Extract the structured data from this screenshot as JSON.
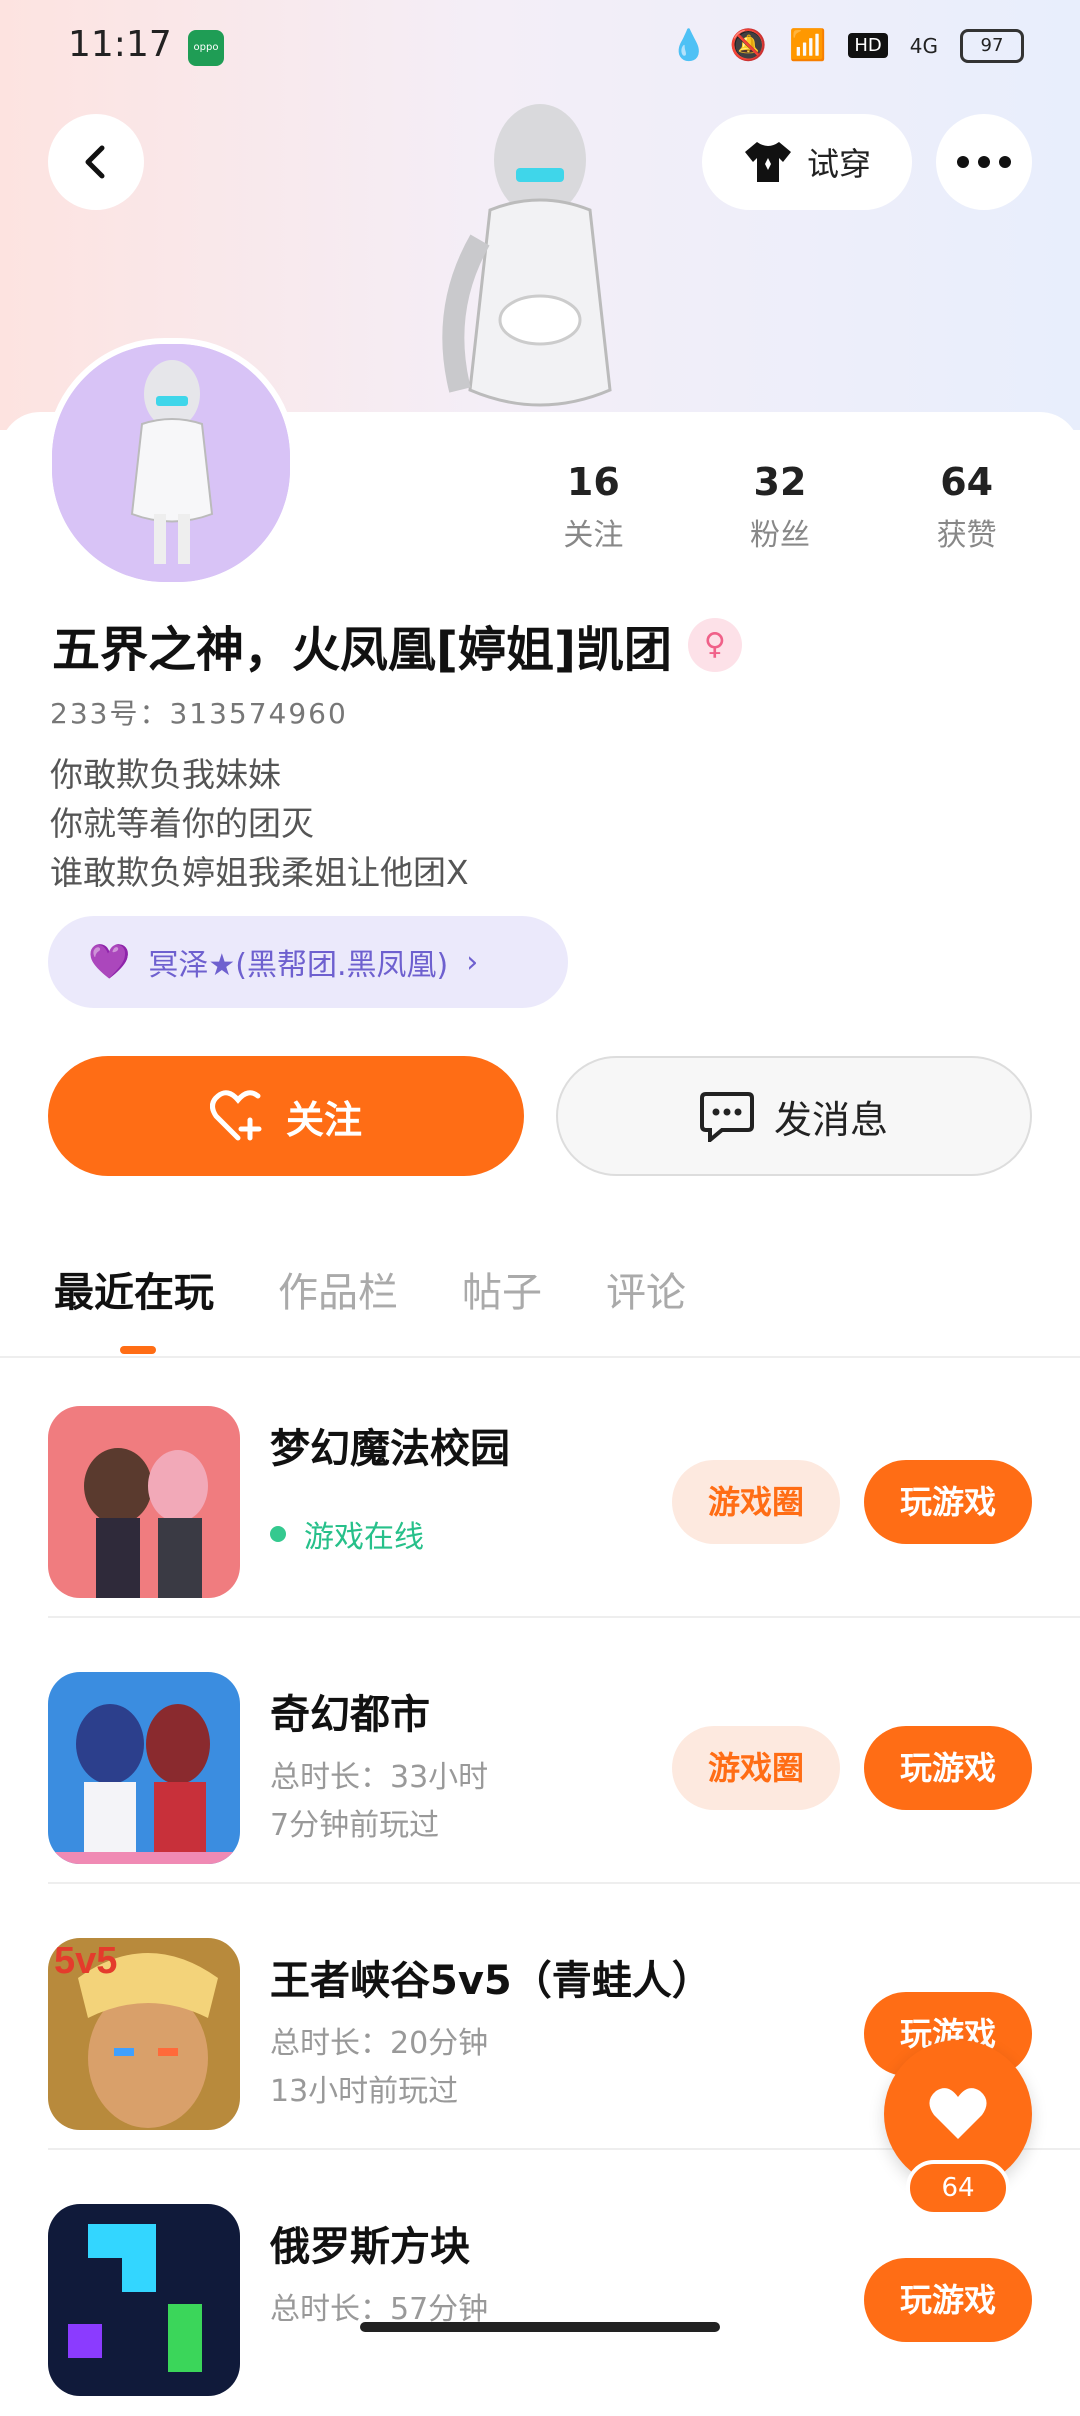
{
  "status_bar": {
    "time": "11:17",
    "carrier_badge": "oppo",
    "battery": "97",
    "hd": "HD",
    "network": "4G"
  },
  "header": {
    "try_label": "试穿"
  },
  "profile": {
    "stats": [
      {
        "value": "16",
        "label": "关注"
      },
      {
        "value": "32",
        "label": "粉丝"
      },
      {
        "value": "64",
        "label": "获赞"
      }
    ],
    "name": "五界之神，火凤凰[婷姐]凯团",
    "uid": "233号：313574960",
    "bio": [
      "你敢欺负我妹妹",
      "你就等着你的团灭",
      "谁敢欺负婷姐我柔姐让他团X"
    ],
    "group": "冥泽★(黑帮团.黑凤凰)"
  },
  "actions": {
    "follow": "关注",
    "message": "发消息"
  },
  "tabs": [
    "最近在玩",
    "作品栏",
    "帖子",
    "评论"
  ],
  "games": [
    {
      "title": "梦幻魔法校园",
      "online": "游戏在线",
      "circle_btn": "游戏圈",
      "play_btn": "玩游戏"
    },
    {
      "title": "奇幻都市",
      "duration": "总时长：33小时",
      "last": "7分钟前玩过",
      "circle_btn": "游戏圈",
      "play_btn": "玩游戏"
    },
    {
      "title": "王者峡谷5v5（青蛙人）",
      "duration": "总时长：20分钟",
      "last": "13小时前玩过",
      "play_btn": "玩游戏",
      "thumb_label": "5v5"
    },
    {
      "title": "俄罗斯方块",
      "duration": "总时长：57分钟",
      "play_btn": "玩游戏"
    }
  ],
  "like_count": "64",
  "colors": {
    "accent": "#ff6d15",
    "group_text": "#6e60cf",
    "online": "#27c08a"
  }
}
